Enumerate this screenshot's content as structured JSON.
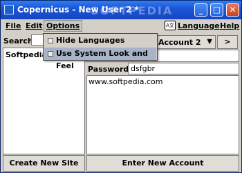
{
  "window": {
    "title": "Copernicus - New User 2 *"
  },
  "title_buttons": {
    "minimize": "_",
    "maximize": "□",
    "close": "✕"
  },
  "watermark": "SOFTPEDIA",
  "menu": {
    "file": "File",
    "edit": "Edit",
    "options": "Options",
    "language": "Language",
    "help": "Help",
    "language_icon": "A文"
  },
  "options_menu": {
    "items": [
      {
        "label": "Hide Languages",
        "checked": false
      },
      {
        "label": "Use System Look and Feel",
        "checked": false
      }
    ]
  },
  "left": {
    "search_label": "Search:",
    "search_value": "",
    "list_items": [
      "Softpedia"
    ],
    "new_site_button": "Create New Site"
  },
  "right": {
    "account_select": "Account 2",
    "nav_button": ">",
    "password_label": "Password:",
    "password_value": "dsfgbr",
    "notes": "www.softpedia.com",
    "enter_account_button": "Enter New Account"
  }
}
